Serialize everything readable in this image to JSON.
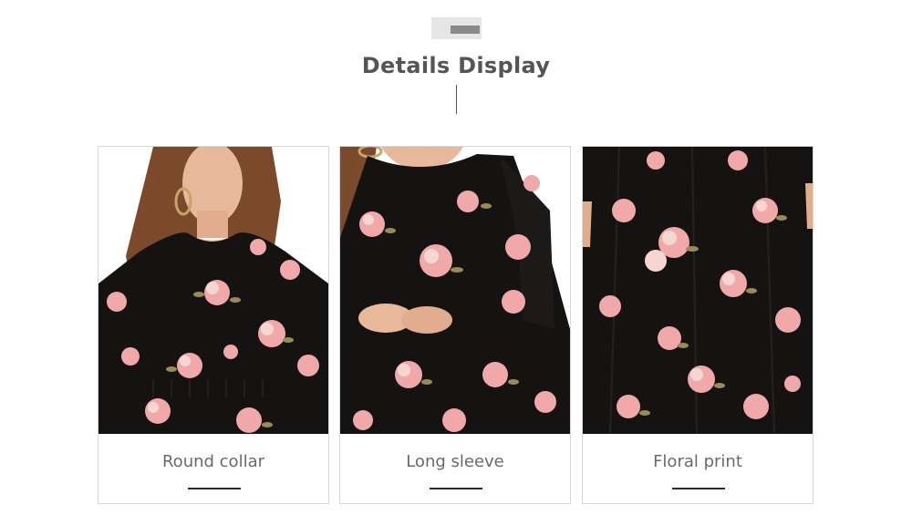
{
  "section": {
    "title": "Details Display"
  },
  "cards": [
    {
      "caption": "Round collar",
      "photo": "model wearing black floral dress, round collar view"
    },
    {
      "caption": "Long sleeve",
      "photo": "close-up of long sleeve with floral pattern"
    },
    {
      "caption": "Floral print",
      "photo": "close-up of dress fabric floral print"
    }
  ],
  "colors": {
    "dress": "#141312",
    "flower_pink": "#f0a8a8",
    "flower_light": "#f6d6d2",
    "leaf": "#9a8a55",
    "skin": "#e8b89a",
    "hair": "#7a4a2a"
  }
}
